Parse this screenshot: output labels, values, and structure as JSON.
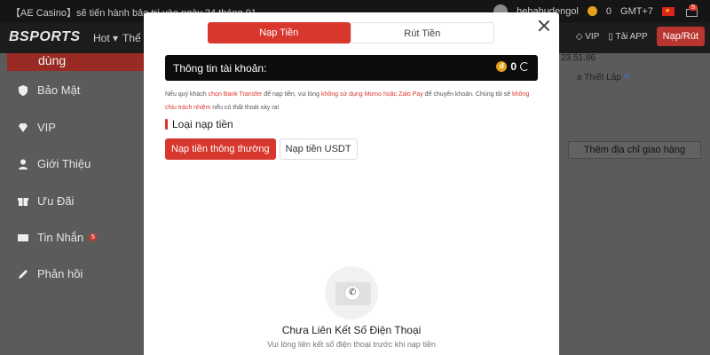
{
  "topbar": {
    "ticker": "【AE Casino】sẽ tiến hành bảo trì vào ngày 24 tháng 01",
    "username": "hehahudengol",
    "balance": "0",
    "timezone": "GMT+7",
    "notification_count": "5"
  },
  "navbar": {
    "logo": "BSPORTS",
    "hot": "Hot",
    "the_thao": "Thể t",
    "vip": "VIP",
    "app": "Tải APP",
    "nap_rut": "Nạp/Rút"
  },
  "sidebar": {
    "active_label": "dùng",
    "items": [
      {
        "label": "Bảo Mật"
      },
      {
        "label": "VIP"
      },
      {
        "label": "Giới Thiệu"
      },
      {
        "label": "Ưu Đãi"
      },
      {
        "label": "Tin Nhắn",
        "badge": "5"
      },
      {
        "label": "Phản hồi"
      }
    ]
  },
  "background_right": {
    "ip": "23.51.86",
    "setting_link": "a Thiết Lập",
    "address_button": "Thêm địa chỉ giao hàng"
  },
  "modal": {
    "tabs": {
      "deposit": "Nạp Tiền",
      "withdraw": "Rút Tiền"
    },
    "account": {
      "label": "Thông tin tài khoản:",
      "balance": "0",
      "coin_symbol": "đ"
    },
    "notice": {
      "p1": "Nếu quý khách ",
      "r1": "chọn Bank Transfer",
      "p2": " để nạp tiền, vui lòng ",
      "r2": "không sử dụng Momo hoặc Zalo Pay",
      "p3": " để chuyển khoản. Chúng tôi sẽ ",
      "r3": "không chịu trách nhiệm",
      "p4": " nếu có thất thoát xảy ra!"
    },
    "section_title": "Loại nạp tiền",
    "deposit_types": [
      "Nạp tiền thông thường",
      "Nạp tiền USDT"
    ],
    "empty": {
      "title": "Chưa Liên Kết Số Điện Thoại",
      "subtitle": "Vui lòng liên kết số điện thoại trước khi nạp tiền"
    }
  },
  "colors": {
    "accent": "#d8372d",
    "account_bg": "#0c0c0c"
  }
}
